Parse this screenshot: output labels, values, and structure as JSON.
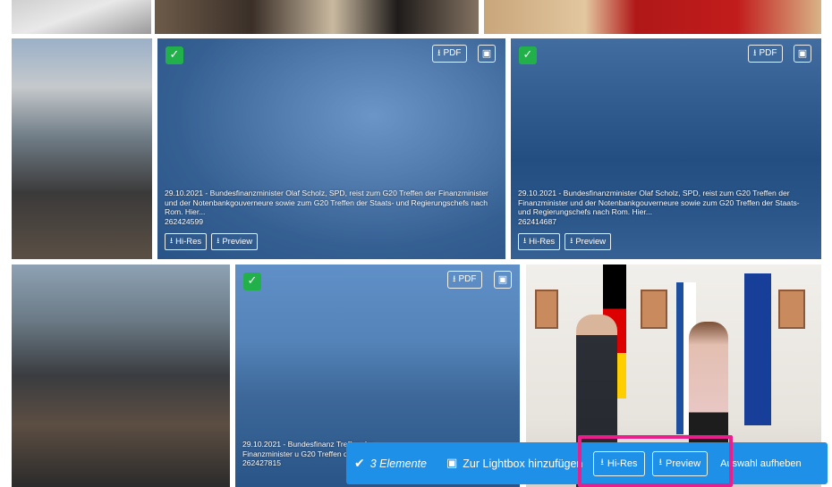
{
  "colors": {
    "selection_overlay": "#2870c4",
    "check_badge": "#22b04b",
    "action_bar": "#1e90e8",
    "highlight": "#ea1f8c"
  },
  "tiles": [
    {
      "selected": true,
      "pdf_label": "PDF",
      "caption": "29.10.2021 - Bundesfinanzminister Olaf Scholz, SPD, reist zum G20 Treffen der Finanzminister und der Notenbankgouverneure sowie zum G20 Treffen der Staats- und Regierungschefs nach Rom. Hier...",
      "image_id": "262424599",
      "hires_label": "Hi-Res",
      "preview_label": "Preview"
    },
    {
      "selected": true,
      "pdf_label": "PDF",
      "caption": "29.10.2021 - Bundesfinanzminister Olaf Scholz, SPD, reist zum G20 Treffen der Finanzminister und der Notenbankgouverneure sowie zum G20 Treffen der Staats- und Regierungschefs nach Rom. Hier...",
      "image_id": "262414687",
      "hires_label": "Hi-Res",
      "preview_label": "Preview"
    },
    {
      "selected": true,
      "pdf_label": "PDF",
      "caption": "29.10.2021 - Bundesfinanz Treffen der Finanzminister u G20 Treffen der Staats- und",
      "image_id": "262427815"
    }
  ],
  "action_bar": {
    "count_text": "3 Elemente",
    "lightbox_text": "Zur Lightbox hinzufügen",
    "hires_label": "Hi-Res",
    "preview_label": "Preview",
    "clear_text": "Auswahl aufheben"
  },
  "icons": {
    "check": "check-icon",
    "download": "download-icon",
    "lightbox": "lightbox-icon"
  }
}
